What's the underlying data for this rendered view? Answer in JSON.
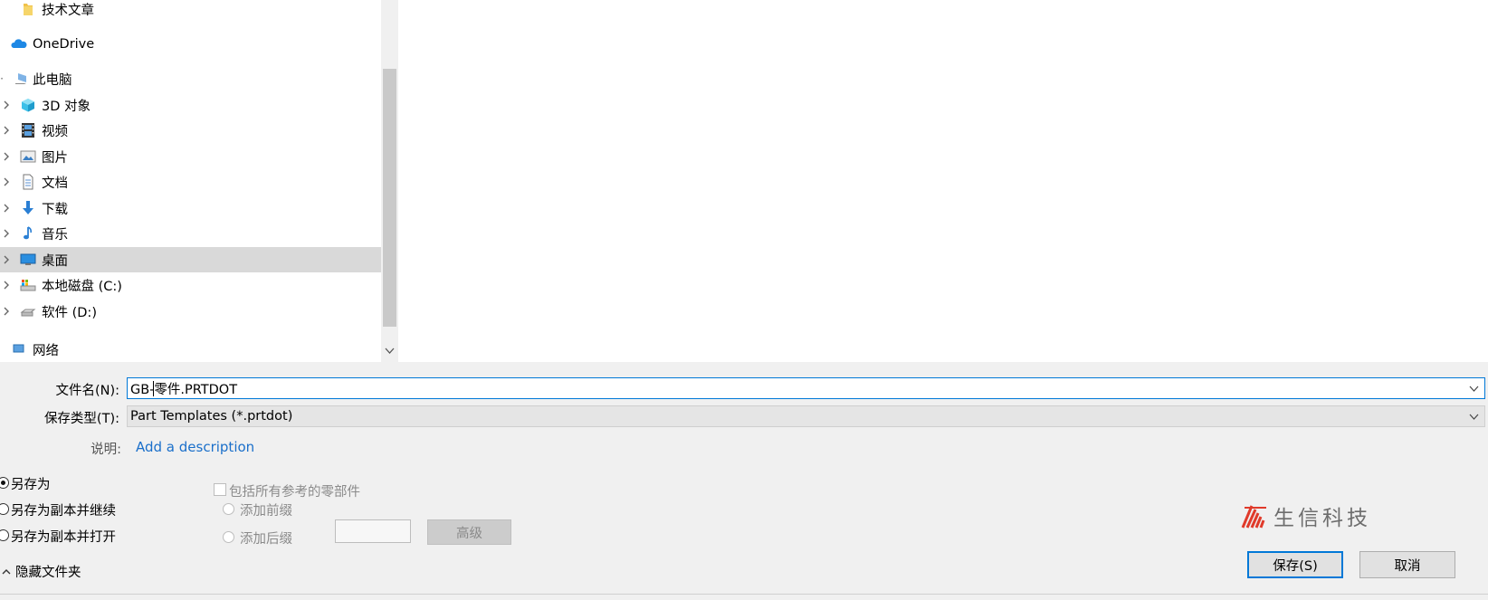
{
  "nav": {
    "items": [
      {
        "label": "技术文章",
        "icon": "folder-icon"
      },
      {
        "label": "OneDrive",
        "icon": "onedrive-cloud-icon"
      },
      {
        "label": "此电脑",
        "icon": "this-pc-icon"
      },
      {
        "label": "3D 对象",
        "icon": "3d-objects-icon"
      },
      {
        "label": "视频",
        "icon": "video-icon"
      },
      {
        "label": "图片",
        "icon": "pictures-icon"
      },
      {
        "label": "文档",
        "icon": "documents-icon"
      },
      {
        "label": "下载",
        "icon": "download-icon"
      },
      {
        "label": "音乐",
        "icon": "music-icon"
      },
      {
        "label": "桌面",
        "icon": "desktop-icon"
      },
      {
        "label": "本地磁盘 (C:)",
        "icon": "system-drive-icon"
      },
      {
        "label": "软件 (D:)",
        "icon": "drive-icon"
      },
      {
        "label": "网络",
        "icon": "network-icon"
      }
    ],
    "selected": "桌面"
  },
  "form": {
    "filename_label": "文件名(N):",
    "filename_value": "GB-零件.PRTDOT",
    "filetype_label": "保存类型(T):",
    "filetype_value": "Part Templates (*.prtdot)",
    "description_label": "说明:",
    "description_link": "Add a description"
  },
  "options": {
    "save_as": "另存为",
    "save_copy_continue": "另存为副本并继续",
    "save_copy_open": "另存为副本并打开",
    "include_refs": "包括所有参考的零部件",
    "add_prefix": "添加前缀",
    "add_suffix": "添加后缀",
    "advanced": "高级",
    "selected": "另存为"
  },
  "hide_folders_label": "隐藏文件夹",
  "logo_text": "生信科技",
  "buttons": {
    "save": "保存(S)",
    "cancel": "取消"
  },
  "colors": {
    "accent": "#0078d7",
    "selection": "#d9d9d9",
    "link": "#1a6fca",
    "logo_red": "#e03a2a"
  }
}
